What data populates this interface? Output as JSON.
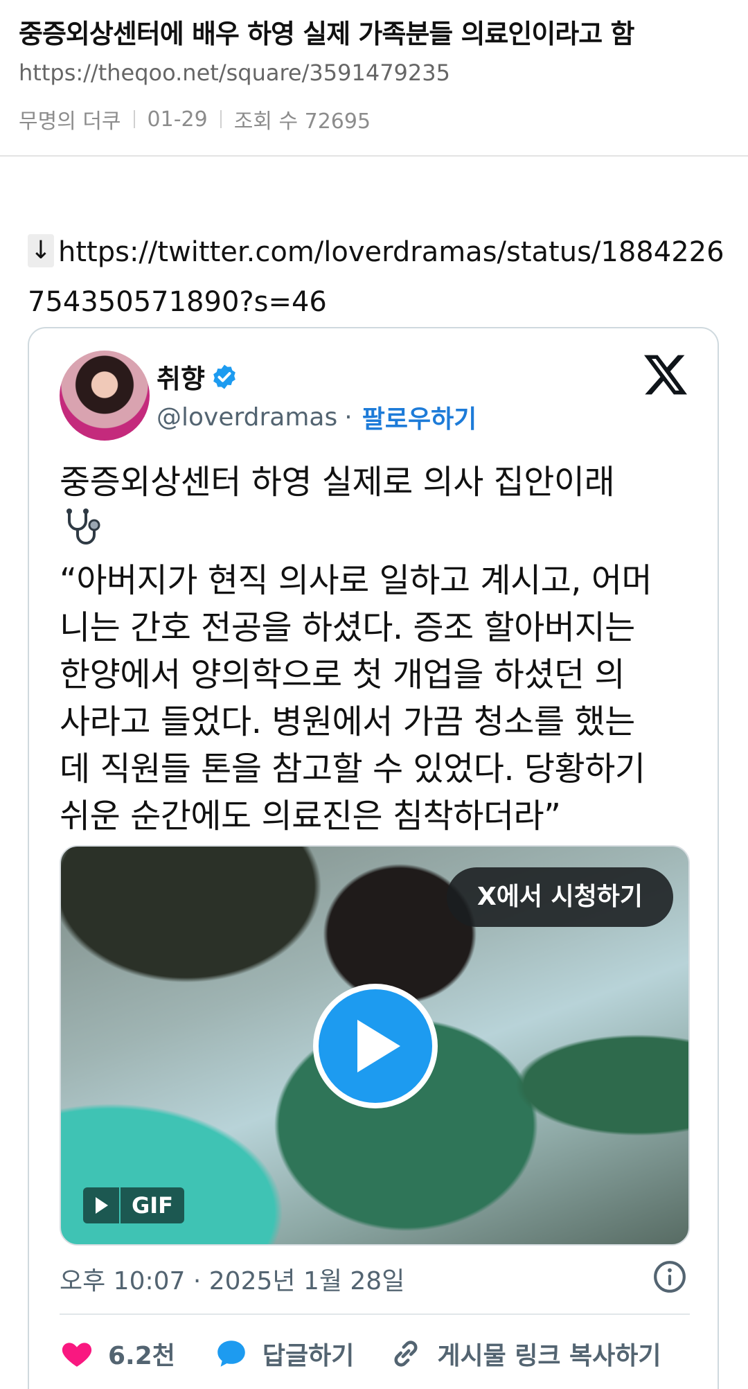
{
  "post": {
    "title": "중증외상센터에 배우 하영 실제 가족분들 의료인이라고 함",
    "url": "https://theqoo.net/square/3591479235",
    "author": "무명의 더쿠",
    "date": "01-29",
    "views_label": "조회 수 72695"
  },
  "body": {
    "arrow": "↓",
    "link": "https://twitter.com/loverdramas/status/1884226754350571890?s=46"
  },
  "tweet": {
    "display_name": "취향",
    "handle": "@loverdramas",
    "separator": "·",
    "follow_label": "팔로우하기",
    "text_lines": [
      "중증외상센터 하영 실제로 의사 집안이래",
      "“아버지가 현직 의사로 일하고 계시고, 어머",
      "니는 간호 전공을 하셨다. 증조 할아버지는",
      "한양에서 양의학으로 첫 개업을 하셨던 의",
      "사라고 들었다. 병원에서 가끔 청소를 했는",
      "데 직원들 톤을 참고할 수 있었다. 당황하기",
      "쉬운 순간에도 의료진은 침착하더라”"
    ],
    "watch_label": "X에서 시청하기",
    "gif_label": "GIF",
    "timestamp": "오후 10:07 · 2025년 1월 28일",
    "like_count": "6.2천",
    "reply_label": "답글하기",
    "copy_link_label": "게시물 링크 복사하기"
  },
  "colors": {
    "accent": "#1d9bf0",
    "follow": "#1d7bd8",
    "like": "#f91880",
    "muted": "#536471"
  },
  "icons": [
    "verified-badge-icon",
    "x-logo-icon",
    "stethoscope-icon",
    "play-icon",
    "info-icon",
    "heart-icon",
    "reply-bubble-icon",
    "link-icon"
  ]
}
